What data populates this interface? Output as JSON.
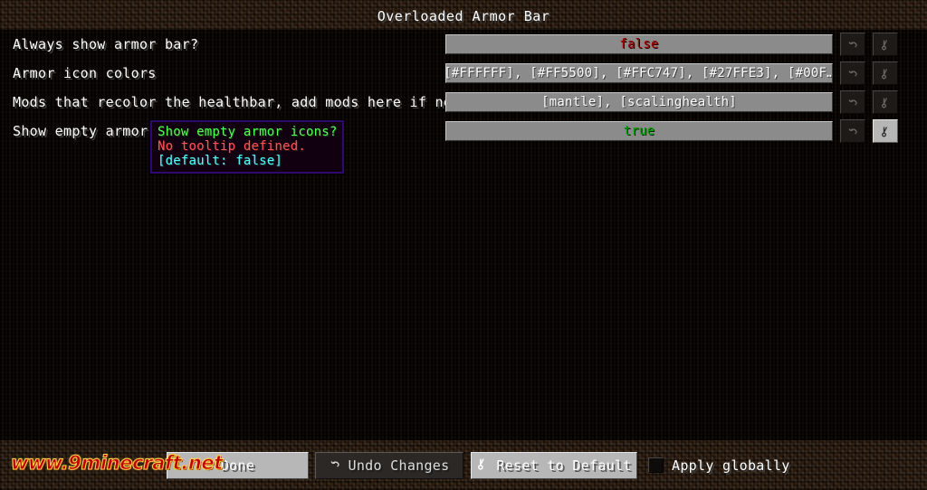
{
  "window": {
    "title": "Overloaded Armor Bar"
  },
  "rows": [
    {
      "label": "Always show armor bar?",
      "value": "false",
      "value_kind": "false",
      "undo_icon": "undo-arrow-icon",
      "reset_icon": "reset-default-icon",
      "reset_hovered": false
    },
    {
      "label": "Armor icon colors",
      "value": "[#FFFFFF], [#FF5500], [#FFC747], [#27FFE3], [#00F…",
      "value_kind": "white",
      "undo_icon": "undo-arrow-icon",
      "reset_icon": "reset-default-icon",
      "reset_hovered": false
    },
    {
      "label": "Mods that recolor the healthbar, add mods here if needed",
      "value": "[mantle], [scalinghealth]",
      "value_kind": "white",
      "undo_icon": "undo-arrow-icon",
      "reset_icon": "reset-default-icon",
      "reset_hovered": false
    },
    {
      "label": "Show empty armor icons?",
      "value": "true",
      "value_kind": "true",
      "undo_icon": "undo-arrow-icon",
      "reset_icon": "reset-default-icon",
      "reset_hovered": true
    }
  ],
  "tooltip": {
    "title": "Show empty armor icons?",
    "description": "No tooltip defined.",
    "default_line": "[default: false]"
  },
  "bottom_bar": {
    "done_label": "Done",
    "undo_label": "Undo Changes",
    "reset_label": "Reset to Default",
    "apply_globally_label": "Apply globally",
    "apply_globally_checked": false
  },
  "watermark": {
    "text": "www.9minecraft.net"
  },
  "colors": {
    "dirt": "#51351d",
    "field": "#8b8b8b",
    "value_false": "#a00000",
    "value_true": "#00a000",
    "tooltip_border": "#2d0a6b",
    "tooltip_title": "#55ff55",
    "tooltip_desc": "#ff5555",
    "tooltip_default": "#55ffff",
    "watermark": "#c00000"
  }
}
